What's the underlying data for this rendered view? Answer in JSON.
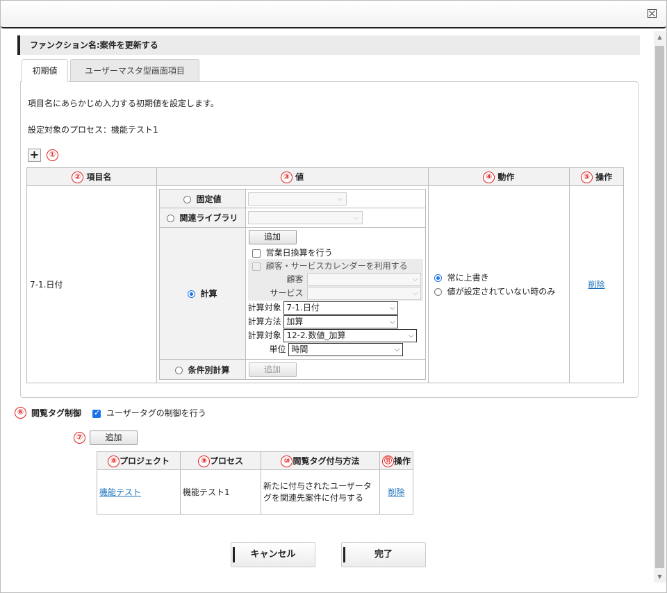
{
  "function_header": "ファンクション名:案件を更新する",
  "tabs": [
    "初期値",
    "ユーザーマスタ型画面項目"
  ],
  "description": "項目名にあらかじめ入力する初期値を設定します。",
  "process_label": "設定対象のプロセス：機能テスト1",
  "markers": [
    "①",
    "②",
    "③",
    "④",
    "⑤",
    "⑥",
    "⑦",
    "⑧",
    "⑨",
    "⑩",
    "⑪"
  ],
  "main_table": {
    "headers": [
      "項目名",
      "値",
      "動作",
      "操作"
    ],
    "row": {
      "item_name": "7-1.日付",
      "value_options": {
        "fixed": "固定値",
        "library": "関連ライブラリ",
        "calc": "計算",
        "conditional": "条件別計算"
      },
      "add_label": "追加",
      "business_day": "営業日換算を行う",
      "calendar": "顧客・サービスカレンダーを利用する",
      "customer_label": "顧客",
      "service_label": "サービス",
      "calc_target_label": "計算対象",
      "calc_target_value": "7-1.日付",
      "calc_method_label": "計算方法",
      "calc_method_value": "加算",
      "calc_target2_label": "計算対象",
      "calc_target2_value": "12-2.数値_加算",
      "unit_label": "単位",
      "unit_value": "時間",
      "action_options": [
        "常に上書き",
        "値が設定されていない時のみ"
      ],
      "delete": "削除"
    }
  },
  "tag_control": {
    "label": "閲覧タグ制御",
    "checkbox_label": "ユーザータグの制御を行う",
    "add_label": "追加"
  },
  "tag_table": {
    "headers": [
      "プロジェクト",
      "プロセス",
      "閲覧タグ付与方法",
      "操作"
    ],
    "row": {
      "project": "機能テスト",
      "process": "機能テスト1",
      "method": "新たに付与されたユーザータグを関連先案件に付与する",
      "delete": "削除"
    }
  },
  "buttons": {
    "cancel": "キャンセル",
    "done": "完了"
  },
  "colors": {
    "accent": "#1a73e8",
    "marker": "#e02020",
    "link": "#1a6fbd"
  }
}
